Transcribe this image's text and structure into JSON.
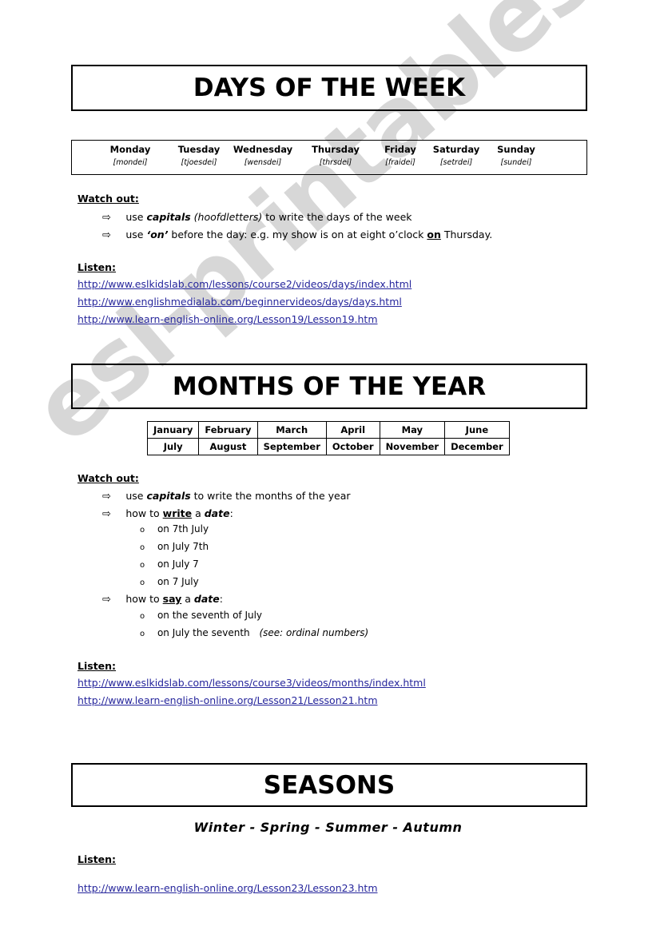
{
  "watermark": {
    "text": "esl-printables.com"
  },
  "sections": {
    "days": {
      "banner_title": "DAYS OF THE WEEK",
      "table": [
        {
          "name": "Monday",
          "pronunciation": "[mondei]"
        },
        {
          "name": "Tuesday",
          "pronunciation": "[tjoesdei]"
        },
        {
          "name": "Wednesday",
          "pronunciation": "[wensdei]"
        },
        {
          "name": "Thursday",
          "pronunciation": "[thrsdei]"
        },
        {
          "name": "Friday",
          "pronunciation": "[fraidei]"
        },
        {
          "name": "Saturday",
          "pronunciation": "[setrdei]"
        },
        {
          "name": "Sunday",
          "pronunciation": "[sundei]"
        }
      ],
      "watch_out_label": "Watch out:",
      "rules": {
        "rule1_pre": "use ",
        "rule1_bold": "capitals",
        "rule1_italic": " (hoofdletters)",
        "rule1_post": " to write the days of the week",
        "rule2_pre": "use ",
        "rule2_bold": "‘on’",
        "rule2_mid": " before the day: e.g. my show is on at eight o’clock ",
        "rule2_ul": "on",
        "rule2_post": " Thursday."
      },
      "listen_label": "Listen:",
      "links": [
        "http://www.eslkidslab.com/lessons/course2/videos/days/index.html",
        "http://www.englishmedialab.com/beginnervideos/days/days.html",
        "http://www.learn-english-online.org/Lesson19/Lesson19.htm"
      ]
    },
    "months": {
      "banner_title": "MONTHS OF THE YEAR",
      "table_rows": [
        [
          "January",
          "February",
          "March",
          "April",
          "May",
          "June"
        ],
        [
          "July",
          "August",
          "September",
          "October",
          "November",
          "December"
        ]
      ],
      "watch_out_label": "Watch out:",
      "rules": {
        "rule1_pre": "use ",
        "rule1_bold": "capitals",
        "rule1_post": " to write the months of the year",
        "rule2_pre": "how to ",
        "rule2_ul": "write",
        "rule2_mid": " a ",
        "rule2_bold": "date",
        "rule2_post": ":",
        "rule3_pre": "how to ",
        "rule3_ul": "say",
        "rule3_mid": " a ",
        "rule3_bold": "date",
        "rule3_post": ":"
      },
      "write_examples": [
        "on 7th July",
        "on July 7th",
        "on July 7",
        "on 7 July"
      ],
      "say_examples": [
        {
          "text": "on the seventh of July",
          "note": ""
        },
        {
          "text": "on July the seventh",
          "note": "(see: ordinal numbers)"
        }
      ],
      "listen_label": "Listen:",
      "links": [
        "http://www.eslkidslab.com/lessons/course3/videos/months/index.html",
        "http://www.learn-english-online.org/Lesson21/Lesson21.htm"
      ]
    },
    "seasons": {
      "banner_title": "SEASONS",
      "list": "Winter  -  Spring -  Summer -  Autumn",
      "listen_label": "Listen:",
      "links": [
        "http://www.learn-english-online.org/Lesson23/Lesson23.htm"
      ]
    }
  },
  "icons": {
    "arrow_bullet": "⇨",
    "circle_bullet": "o"
  },
  "colors": {
    "link": "#26269c",
    "text": "#000000",
    "watermark": "#c9c9c9"
  }
}
